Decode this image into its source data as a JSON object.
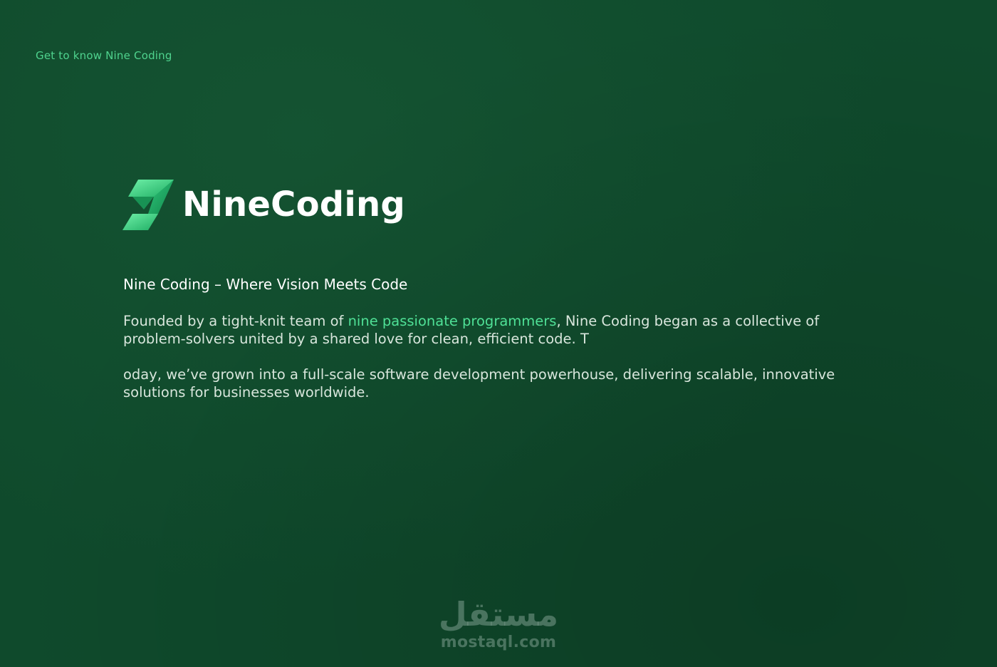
{
  "eyebrow": "Get to know Nine Coding",
  "logo": {
    "name": "NineCoding"
  },
  "headline": "Nine Coding – Where Vision Meets Code",
  "paragraph1": {
    "before": "Founded by a tight-knit team of ",
    "highlight": "nine passionate programmers",
    "after": ", Nine Coding began as a collective of problem-solvers united by a shared love for clean, efficient code. T"
  },
  "paragraph2": "oday, we’ve grown into a full-scale software development powerhouse, delivering scalable, innovative solutions for businesses worldwide.",
  "watermark": {
    "arabic": "مستقل",
    "latin": "mostaql.com"
  },
  "colors": {
    "background": "#0f4a2c",
    "accent": "#4fe096",
    "text": "#ffffff"
  }
}
